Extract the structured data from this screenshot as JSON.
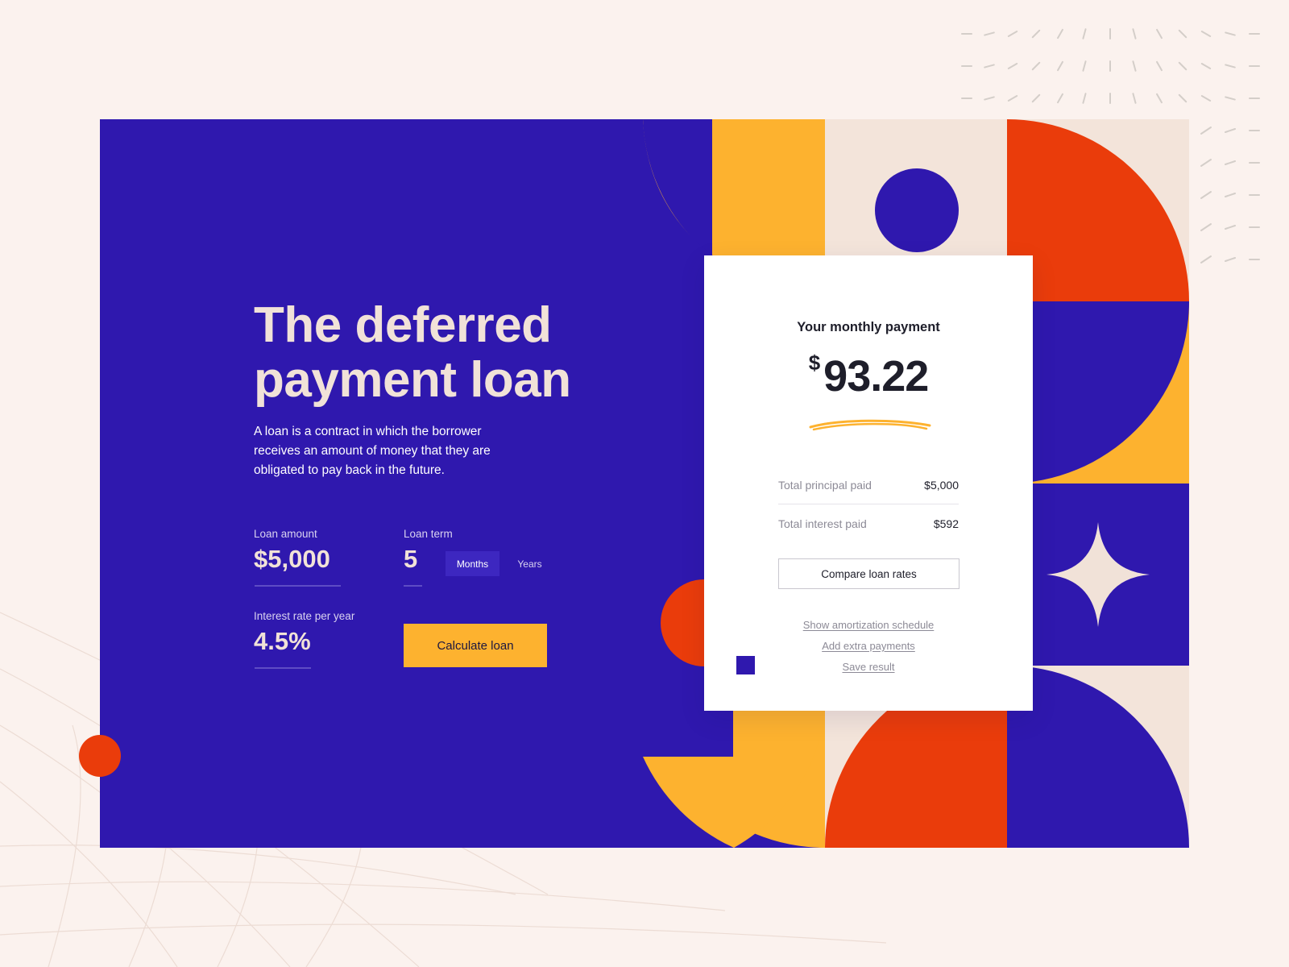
{
  "hero": {
    "title": "The deferred payment loan",
    "description": "A loan is a contract in which the borrower receives an amount of money that they are obligated to pay back in the future."
  },
  "form": {
    "loan_amount_label": "Loan amount",
    "loan_amount_value": "$5,000",
    "loan_term_label": "Loan term",
    "loan_term_value": "5",
    "term_units": [
      {
        "label": "Months",
        "selected": true
      },
      {
        "label": "Years",
        "selected": false
      }
    ],
    "interest_label": "Interest rate per year",
    "interest_value": "4.5%",
    "calculate_label": "Calculate loan"
  },
  "result": {
    "title": "Your monthly payment",
    "currency": "$",
    "amount": "93.22",
    "rows": [
      {
        "label": "Total principal paid",
        "value": "$5,000"
      },
      {
        "label": "Total interest paid",
        "value": "$592"
      }
    ],
    "compare_label": "Compare loan rates",
    "links": [
      "Show amortization schedule",
      "Add extra payments",
      "Save result"
    ]
  },
  "colors": {
    "background": "#fbf2ee",
    "indigo": "#2f18ae",
    "yellow": "#fdb22f",
    "orange": "#ea3c0b",
    "cream": "#f1e2d8"
  }
}
